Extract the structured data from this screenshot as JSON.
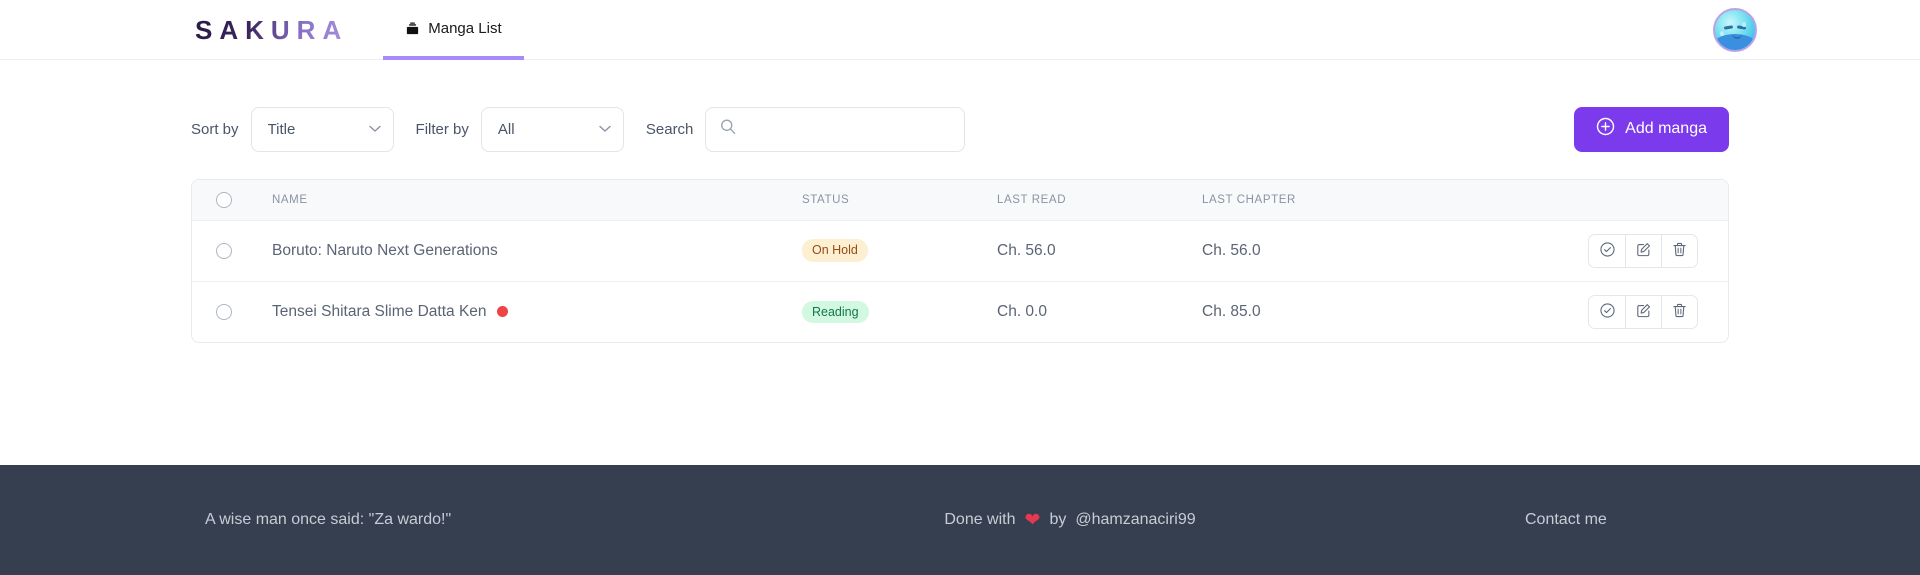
{
  "navbar": {
    "brand": "SAKURA",
    "tabs": [
      {
        "label": "Manga List",
        "icon": "book-icon",
        "active": true
      }
    ],
    "avatar_name": "user-avatar"
  },
  "controls": {
    "sort_label": "Sort by",
    "sort_value": "Title",
    "sort_options": [
      "Title"
    ],
    "filter_label": "Filter by",
    "filter_value": "All",
    "filter_options": [
      "All"
    ],
    "search_label": "Search",
    "search_value": "",
    "search_placeholder": "",
    "add_button": "Add manga"
  },
  "table": {
    "columns": [
      "",
      "NAME",
      "STATUS",
      "LAST READ",
      "LAST CHAPTER",
      ""
    ],
    "rows": [
      {
        "name": "Boruto: Naruto Next Generations",
        "has_dot": false,
        "status": "On Hold",
        "status_kind": "onhold",
        "last_read": "Ch. 56.0",
        "last_chapter": "Ch. 56.0"
      },
      {
        "name": "Tensei Shitara Slime Datta Ken",
        "has_dot": true,
        "status": "Reading",
        "status_kind": "reading",
        "last_read": "Ch. 0.0",
        "last_chapter": "Ch. 85.0"
      }
    ],
    "row_actions": [
      "check-circle-icon",
      "edit-icon",
      "trash-icon"
    ]
  },
  "footer": {
    "quote": "A wise man once said: \"Za wardo!\"",
    "made_with_prefix": "Done with",
    "made_with_mid": "by",
    "author": "@hamzanaciri99",
    "contact": "Contact me"
  },
  "colors": {
    "accent": "#7c3aed",
    "tab_underline": "#a78bfa",
    "footer_bg": "#363f4f",
    "badge_onhold_bg": "#fdf0d2",
    "badge_onhold_fg": "#9a4a14",
    "badge_reading_bg": "#d3f8e2",
    "badge_reading_fg": "#11774b",
    "dot": "#ef4444",
    "heart": "#e8384f"
  }
}
